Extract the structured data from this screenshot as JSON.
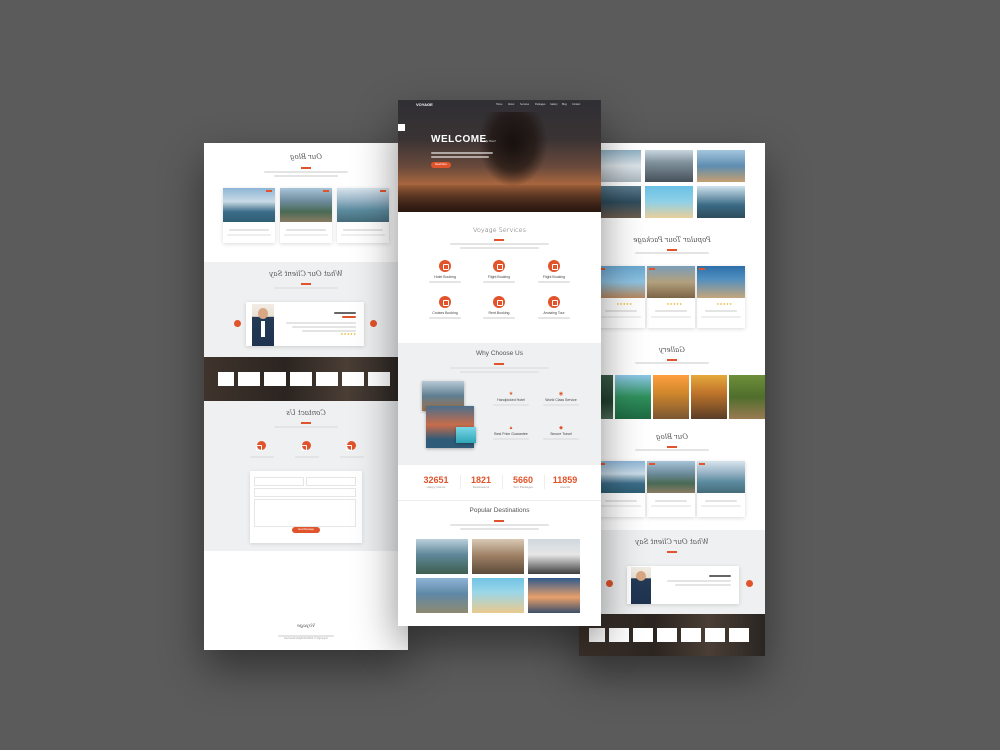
{
  "colors": {
    "background": "#5b5b5b",
    "accent": "#e0532b",
    "page": "#ffffff",
    "band": "#eef0f1"
  },
  "hero": {
    "brand": "VOYAGE",
    "nav": [
      "Home",
      "About",
      "Services",
      "Packages",
      "Gallery",
      "Blog",
      "Contact"
    ],
    "title": "WELCOME",
    "title_suffix": "To My Tour!",
    "button": "Read More"
  },
  "services": {
    "title": "Voyage Services",
    "items": [
      {
        "label": "Hotel Booking",
        "icon": "hotel-icon"
      },
      {
        "label": "Flight Booking",
        "icon": "plane-icon"
      },
      {
        "label": "Flight Booking",
        "icon": "ticket-icon"
      },
      {
        "label": "Cruises Booking",
        "icon": "ship-icon"
      },
      {
        "label": "Rent Booking",
        "icon": "car-icon"
      },
      {
        "label": "Amazing Tour",
        "icon": "map-icon"
      }
    ]
  },
  "why": {
    "title": "Why Choose Us",
    "features": [
      "Handpicked Hotel",
      "World Class Service",
      "Best Price Guarantee",
      "Secure Travel"
    ]
  },
  "stats": [
    {
      "number": "32651",
      "caption": "Happy Clients"
    },
    {
      "number": "1821",
      "caption": "Destinations"
    },
    {
      "number": "5660",
      "caption": "Tour Packages"
    },
    {
      "number": "11859",
      "caption": "Awards"
    }
  ],
  "destinations": {
    "title": "Popular Destinations"
  },
  "left": {
    "blog_title": "Our Blog",
    "testimonial_title": "What Our Client Say",
    "contact_title": "Contact Us",
    "send_button": "Send Message",
    "footer_brand": "Voyage",
    "footer_copy": "Copyright © 2018 All Rights Reserved"
  },
  "right": {
    "packages_title": "Popular Tour Package",
    "gallery_title": "Gallery",
    "blog_title": "Our Blog",
    "testimonial_title": "What Our Client Say"
  }
}
